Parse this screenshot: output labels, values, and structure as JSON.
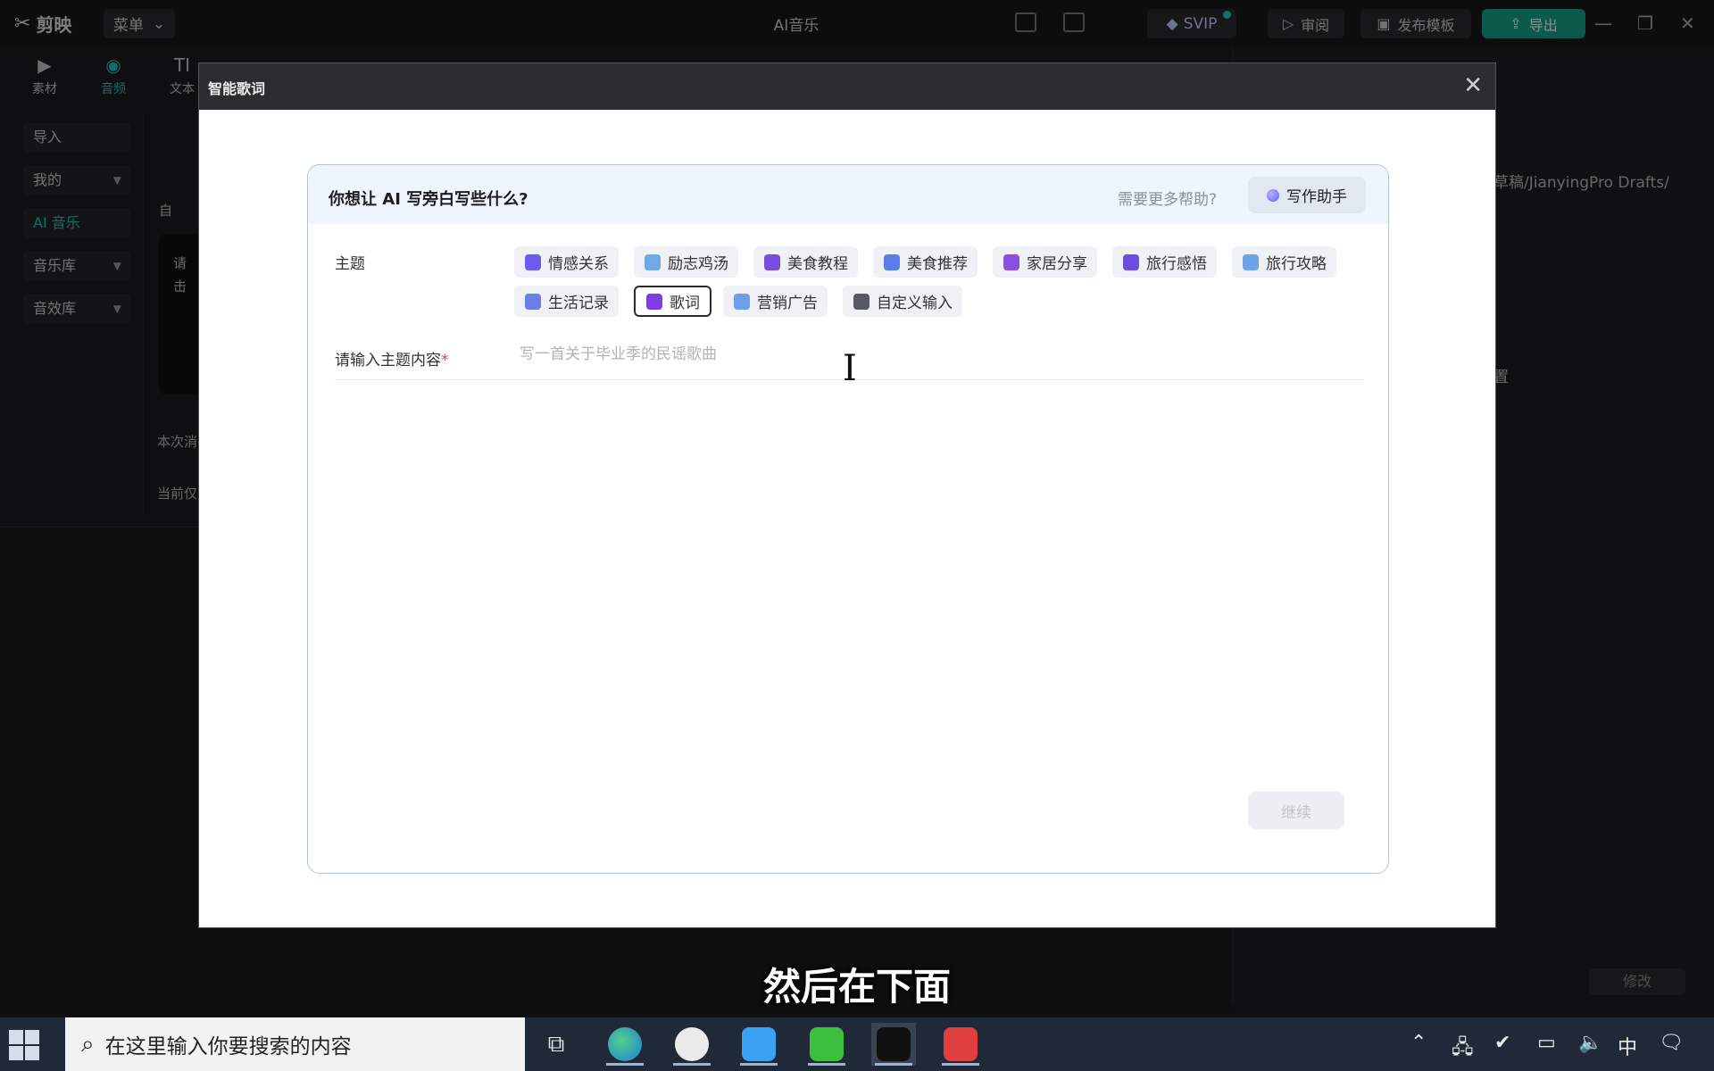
{
  "topbar": {
    "logo": "剪映",
    "menu_label": "菜单",
    "title": "AI音乐",
    "svip_label": "SVIP",
    "review_label": "审阅",
    "publish_label": "发布模板",
    "export_label": "导出"
  },
  "tools": [
    {
      "label": "素材",
      "icon": "play-square-icon"
    },
    {
      "label": "音频",
      "icon": "audio-icon"
    },
    {
      "label": "文本",
      "icon": "text-icon"
    }
  ],
  "leftnav": [
    {
      "label": "导入"
    },
    {
      "label": "我的"
    },
    {
      "label": "AI 音乐"
    },
    {
      "label": "音乐库"
    },
    {
      "label": "音效库"
    }
  ],
  "background_fragments": {
    "auto_check": "自",
    "hint_1": "请",
    "hint_2": "击",
    "consume": "本次消",
    "current": "当前仅",
    "path": "草稿/JianyingPro Drafts/",
    "setting": "置",
    "modify": "修改"
  },
  "modal": {
    "title": "智能歌词",
    "question": "你想让 AI 写旁白写些什么?",
    "help_text": "需要更多帮助?",
    "assistant_label": "写作助手",
    "topic_label": "主题",
    "input_label": "请输入主题内容",
    "required_mark": "*",
    "input_placeholder": "写一首关于毕业季的民谣歌曲",
    "input_value": "",
    "continue_label": "继续",
    "topics": [
      {
        "label": "情感关系",
        "icon": "person-heart-icon",
        "color": "#6a5cf0"
      },
      {
        "label": "励志鸡汤",
        "icon": "arm-icon",
        "color": "#6fa9e8"
      },
      {
        "label": "美食教程",
        "icon": "cup-icon",
        "color": "#7a4de0"
      },
      {
        "label": "美食推荐",
        "icon": "dish-icon",
        "color": "#5b7de8"
      },
      {
        "label": "家居分享",
        "icon": "person-icon",
        "color": "#8a4fe0"
      },
      {
        "label": "旅行感悟",
        "icon": "photo-icon",
        "color": "#6a4fe0"
      },
      {
        "label": "旅行攻略",
        "icon": "map-pin-icon",
        "color": "#6fa3e8"
      },
      {
        "label": "生活记录",
        "icon": "book-icon",
        "color": "#6a7ee8"
      },
      {
        "label": "歌词",
        "icon": "music-note-icon",
        "color": "#7a3fe0",
        "selected": true
      },
      {
        "label": "营销广告",
        "icon": "billboard-icon",
        "color": "#6f9fe8"
      },
      {
        "label": "自定义输入",
        "icon": "edit-icon",
        "color": "#555a66"
      }
    ]
  },
  "subtitle": "然后在下面",
  "taskbar": {
    "search_text": "在这里输入你要搜索的内容",
    "ime": "中"
  }
}
